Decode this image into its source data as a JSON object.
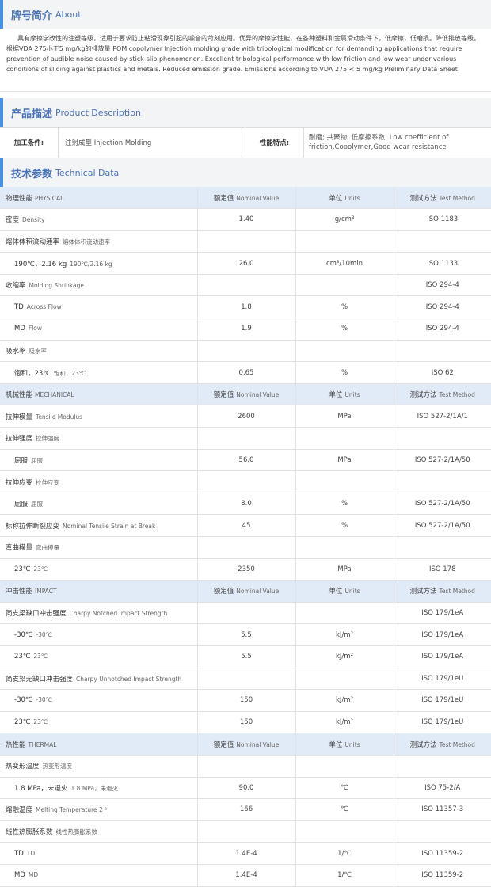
{
  "about": {
    "title_zh": "牌号简介",
    "title_en": "About",
    "text": "具有摩擦学改性的注塑等级，适用于要求防止粘滑现象引起的噪音的苛刻应用。优异的摩擦学性能，在各种塑料和金属滑动条件下，低摩擦，低磨损。降低排放等级。根据VDA 275小于5 mg/kg的排放量  POM copolymer Injection molding grade with tribological modification for demanding applications that require prevention of audible noise caused by stick-slip phenomenon. Excellent tribological performance with low friction and low wear under various conditions of sliding against plastics and metals. Reduced emission grade. Emissions according to VDA 275 < 5 mg/kg Preliminary Data Sheet"
  },
  "description": {
    "title_zh": "产品描述",
    "title_en": "Product Description",
    "processing_label": "加工条件:",
    "processing_value": "注射成型  Injection Molding",
    "features_label": "性能特点:",
    "features_value": "耐磨; 共聚物; 低摩擦系数;   Low coefficient of friction,Copolymer,Good wear resistance"
  },
  "technical": {
    "title_zh": "技术参数",
    "title_en": "Technical Data"
  },
  "header_cols": {
    "nominal_zh": "额定值",
    "nominal_en": "Nominal Value",
    "unit_zh": "单位",
    "unit_en": "Units",
    "method_zh": "测试方法",
    "method_en": "Test Method"
  },
  "rows": [
    {
      "type": "cat",
      "zh": "物理性能",
      "en": "PHYSICAL"
    },
    {
      "type": "row",
      "zh": "密度",
      "en": "Density",
      "value": "1.40",
      "unit": "g/cm³",
      "method": "ISO 1183"
    },
    {
      "type": "row",
      "zh": "熔体体积流动速率",
      "en": "熔体体积流动速率",
      "value": "",
      "unit": "",
      "method": ""
    },
    {
      "type": "row",
      "indent": true,
      "zh": "190℃，2.16 kg",
      "en": "190℃/2.16 kg",
      "value": "26.0",
      "unit": "cm³/10min",
      "method": "ISO 1133",
      "link": true
    },
    {
      "type": "row",
      "zh": "收缩率",
      "en": "Molding Shrinkage",
      "value": "",
      "unit": "",
      "method": "ISO 294-4"
    },
    {
      "type": "row",
      "indent": true,
      "zh": "TD",
      "en": "Across Flow",
      "value": "1.8",
      "unit": "%",
      "method": "ISO 294-4"
    },
    {
      "type": "row",
      "indent": true,
      "zh": "MD",
      "en": "Flow",
      "value": "1.9",
      "unit": "%",
      "method": "ISO 294-4"
    },
    {
      "type": "row",
      "zh": "吸水率",
      "en": "吸水率",
      "value": "",
      "unit": "",
      "method": ""
    },
    {
      "type": "row",
      "indent": true,
      "zh": "饱和，23℃",
      "en": "饱和，23℃",
      "value": "0.65",
      "unit": "%",
      "method": "ISO 62",
      "link": true
    },
    {
      "type": "cat",
      "zh": "机械性能",
      "en": "MECHANICAL"
    },
    {
      "type": "row",
      "zh": "拉伸模量",
      "en": "Tensile Modulus",
      "value": "2600",
      "unit": "MPa",
      "method": "ISO 527-2/1A/1"
    },
    {
      "type": "row",
      "zh": "拉伸强度",
      "en": "拉伸强度",
      "value": "",
      "unit": "",
      "method": ""
    },
    {
      "type": "row",
      "indent": true,
      "zh": "屈服",
      "en": "屈服",
      "value": "56.0",
      "unit": "MPa",
      "method": "ISO 527-2/1A/50"
    },
    {
      "type": "row",
      "zh": "拉伸应变",
      "en": "拉伸应变",
      "value": "",
      "unit": "",
      "method": ""
    },
    {
      "type": "row",
      "indent": true,
      "zh": "屈服",
      "en": "屈服",
      "value": "8.0",
      "unit": "%",
      "method": "ISO 527-2/1A/50"
    },
    {
      "type": "row",
      "zh": "标称拉伸断裂应变",
      "en": "Nominal Tensile Strain at Break",
      "value": "45",
      "unit": "%",
      "method": "ISO 527-2/1A/50"
    },
    {
      "type": "row",
      "zh": "弯曲模量",
      "en": "弯曲模量",
      "value": "",
      "unit": "",
      "method": ""
    },
    {
      "type": "row",
      "indent": true,
      "zh": "23℃",
      "en": "23℃",
      "value": "2350",
      "unit": "MPa",
      "method": "ISO 178"
    },
    {
      "type": "cat",
      "zh": "冲击性能",
      "en": "IMPACT"
    },
    {
      "type": "row",
      "zh": "简支梁缺口冲击强度",
      "en": "Charpy Notched Impact Strength",
      "value": "",
      "unit": "",
      "method": "ISO 179/1eA"
    },
    {
      "type": "row",
      "indent": true,
      "zh": "-30℃",
      "en": "-30℃",
      "value": "5.5",
      "unit": "kJ/m²",
      "method": "ISO 179/1eA"
    },
    {
      "type": "row",
      "indent": true,
      "zh": "23℃",
      "en": "23℃",
      "value": "5.5",
      "unit": "kJ/m²",
      "method": "ISO 179/1eA"
    },
    {
      "type": "row",
      "zh": "简支梁无缺口冲击强度",
      "en": "Charpy Unnotched Impact Strength",
      "value": "",
      "unit": "",
      "method": "ISO 179/1eU"
    },
    {
      "type": "row",
      "indent": true,
      "zh": "-30℃",
      "en": "-30℃",
      "value": "150",
      "unit": "kJ/m²",
      "method": "ISO 179/1eU"
    },
    {
      "type": "row",
      "indent": true,
      "zh": "23℃",
      "en": "23℃",
      "value": "150",
      "unit": "kJ/m²",
      "method": "ISO 179/1eU"
    },
    {
      "type": "cat",
      "zh": "热性能",
      "en": "THERMAL"
    },
    {
      "type": "row",
      "zh": "热变形温度",
      "en": "热变形温度",
      "value": "",
      "unit": "",
      "method": ""
    },
    {
      "type": "row",
      "indent": true,
      "zh": "1.8 MPa，未退火",
      "en": "1.8 MPa，未退火",
      "value": "90.0",
      "unit": "℃",
      "method": "ISO 75-2/A"
    },
    {
      "type": "row",
      "zh": "熔融温度",
      "en": "Melting Temperature   2 ²",
      "value": "166",
      "unit": "℃",
      "method": "ISO 11357-3",
      "link": true
    },
    {
      "type": "row",
      "zh": "线性热膨胀系数",
      "en": "线性热膨胀系数",
      "value": "",
      "unit": "",
      "method": ""
    },
    {
      "type": "row",
      "indent": true,
      "zh": "TD",
      "en": "TD",
      "value": "1.4E-4",
      "unit": "1/℃",
      "method": "ISO 11359-2"
    },
    {
      "type": "row",
      "indent": true,
      "zh": "MD",
      "en": "MD",
      "value": "1.4E-4",
      "unit": "1/℃",
      "method": "ISO 11359-2"
    }
  ]
}
